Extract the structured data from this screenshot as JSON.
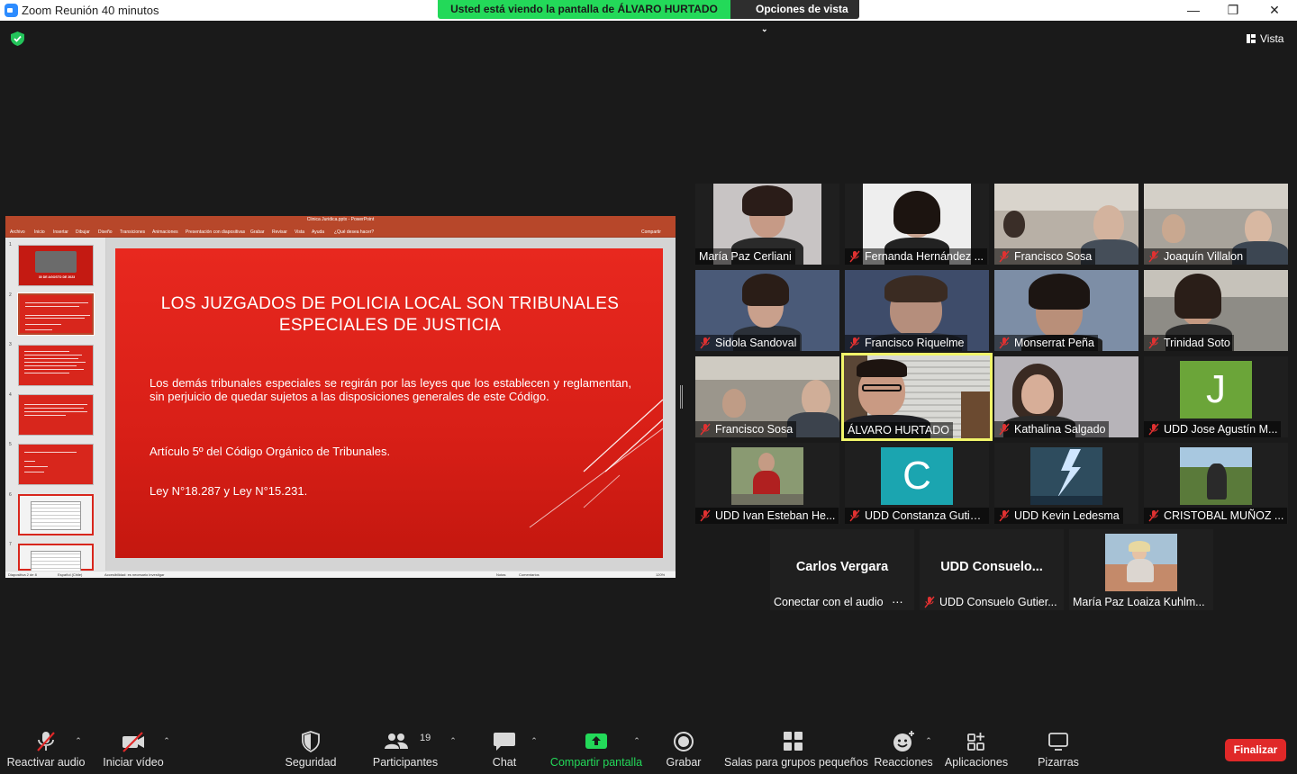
{
  "window": {
    "title": "Zoom Reunión 40 minutos",
    "minimize": "—",
    "maximize": "❐",
    "close": "✕"
  },
  "banner": {
    "sharing_text": "Usted está viendo la pantalla de ÁLVARO HURTADO",
    "view_options": "Opciones de vista"
  },
  "top": {
    "view_label": "Vista"
  },
  "ppt": {
    "file_title": "Clinica Juridica.pptx  -  PowerPoint",
    "ribbon": [
      "Archivo",
      "Inicio",
      "Insertar",
      "Dibujar",
      "Diseño",
      "Transiciones",
      "Animaciones",
      "Presentación con diapositivas",
      "Grabar",
      "Revisar",
      "Vista",
      "Ayuda",
      "¿Qué desea hacer?",
      "Compartir"
    ],
    "thumb_numbers": [
      "1",
      "2",
      "3",
      "4",
      "5",
      "6",
      "7"
    ],
    "thumb1_caption": "30 DE AGOSTO DE 2023",
    "status": [
      "Diapositiva 2 de 8",
      "Español (Chile)",
      "Accesibilidad: es necesario investigar",
      "Notas",
      "Comentarios",
      "120%"
    ]
  },
  "slide": {
    "title": "LOS JUZGADOS DE POLICIA LOCAL SON TRIBUNALES ESPECIALES DE JUSTICIA",
    "p1": "Los demás tribunales especiales se regirán por las leyes que los establecen y reglamentan, sin perjuicio de quedar sujetos a las disposiciones generales de este Código.",
    "p2": "Artículo 5º del Código Orgánico de Tribunales.",
    "p3": "Ley N°18.287 y Ley N°15.231."
  },
  "participants": {
    "p01": "María Paz Cerliani",
    "p02": "Fernanda Hernández ...",
    "p03": "Francisco Sosa",
    "p04": "Joaquín Villalon",
    "p05": "Sidola Sandoval",
    "p06": "Francisco Riquelme",
    "p07": "Monserrat Peña",
    "p08": "Trinidad Soto",
    "p09": "Francisco Sosa",
    "p10": "ÁLVARO HURTADO",
    "p11": "Kathalina Salgado",
    "p12": "UDD Jose Agustín M...",
    "p12_initial": "J",
    "p13": "UDD Ivan Esteban He...",
    "p14": "UDD Constanza Gutie...",
    "p14_initial": "C",
    "p15": "UDD Kevin Ledesma",
    "p16": "CRISTOBAL MUÑOZ ...",
    "p17_big": "Carlos Vergara",
    "p17": "Conectar con el audio",
    "p18_big": "UDD  Consuelo...",
    "p18": "UDD Consuelo Gutier...",
    "p19": "María Paz Loaiza Kuhlm..."
  },
  "colors": {
    "share_green": "#23d959",
    "active_speaker": "#f1f56a",
    "end_red": "#e02828",
    "avatar_green": "#6ba539",
    "avatar_teal": "#1ba5b0",
    "slide_red": "#d81f17"
  },
  "toolbar": {
    "unmute": "Reactivar audio",
    "start_video": "Iniciar vídeo",
    "security": "Seguridad",
    "participants": "Participantes",
    "participants_count": "19",
    "chat": "Chat",
    "share": "Compartir pantalla",
    "record": "Grabar",
    "breakout": "Salas para grupos pequeños",
    "reactions": "Reacciones",
    "apps": "Aplicaciones",
    "whiteboards": "Pizarras",
    "end": "Finalizar"
  }
}
